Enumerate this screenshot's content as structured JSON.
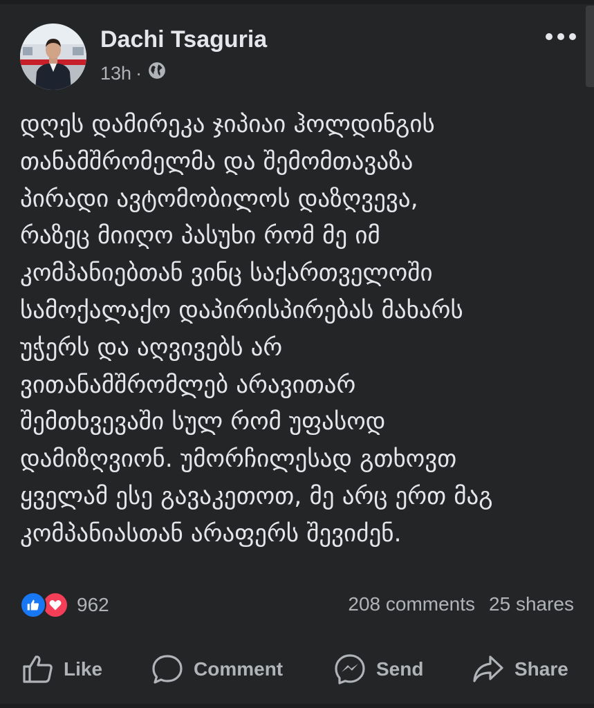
{
  "post": {
    "author": "Dachi Tsaguria",
    "time": "13h",
    "separator": "·",
    "privacy_icon": "globe-icon",
    "more_icon": "more-dots-icon",
    "text_lines": [
      "დღეს დამირეკა ჯიპიაი ჰოლდინგის",
      "თანამშრომელმა და შემომთავაზა",
      "პირადი ავტომობილოს დაზღვევა,",
      "რაზეც მიიღო პასუხი რომ მე იმ",
      "კომპანიებთან ვინც საქართველოში",
      "სამოქალაქო დაპირისპირებას მახარს",
      "უჭერს და აღვივებს არ",
      "ვითანამშრომლებ არავითარ",
      "შემთხვევაში სულ რომ უფასოდ",
      "დამიზღვიონ. უმორჩილესად გთხოვთ",
      "ყველამ ესე გავაკეთოთ, მე არც ერთ მაგ",
      "კომპანიასთან არაფერს შევიძენ."
    ]
  },
  "reactions": {
    "icons": [
      "like-icon",
      "love-icon"
    ],
    "count": "962",
    "comments": "208 comments",
    "shares": "25 shares"
  },
  "actions": {
    "like": "Like",
    "comment": "Comment",
    "send": "Send",
    "share": "Share"
  },
  "colors": {
    "background": "#242526",
    "primary_text": "#e4e6eb",
    "secondary_text": "#b0b3b8",
    "like_blue": "#1877f2",
    "love_red": "#f33e58"
  }
}
